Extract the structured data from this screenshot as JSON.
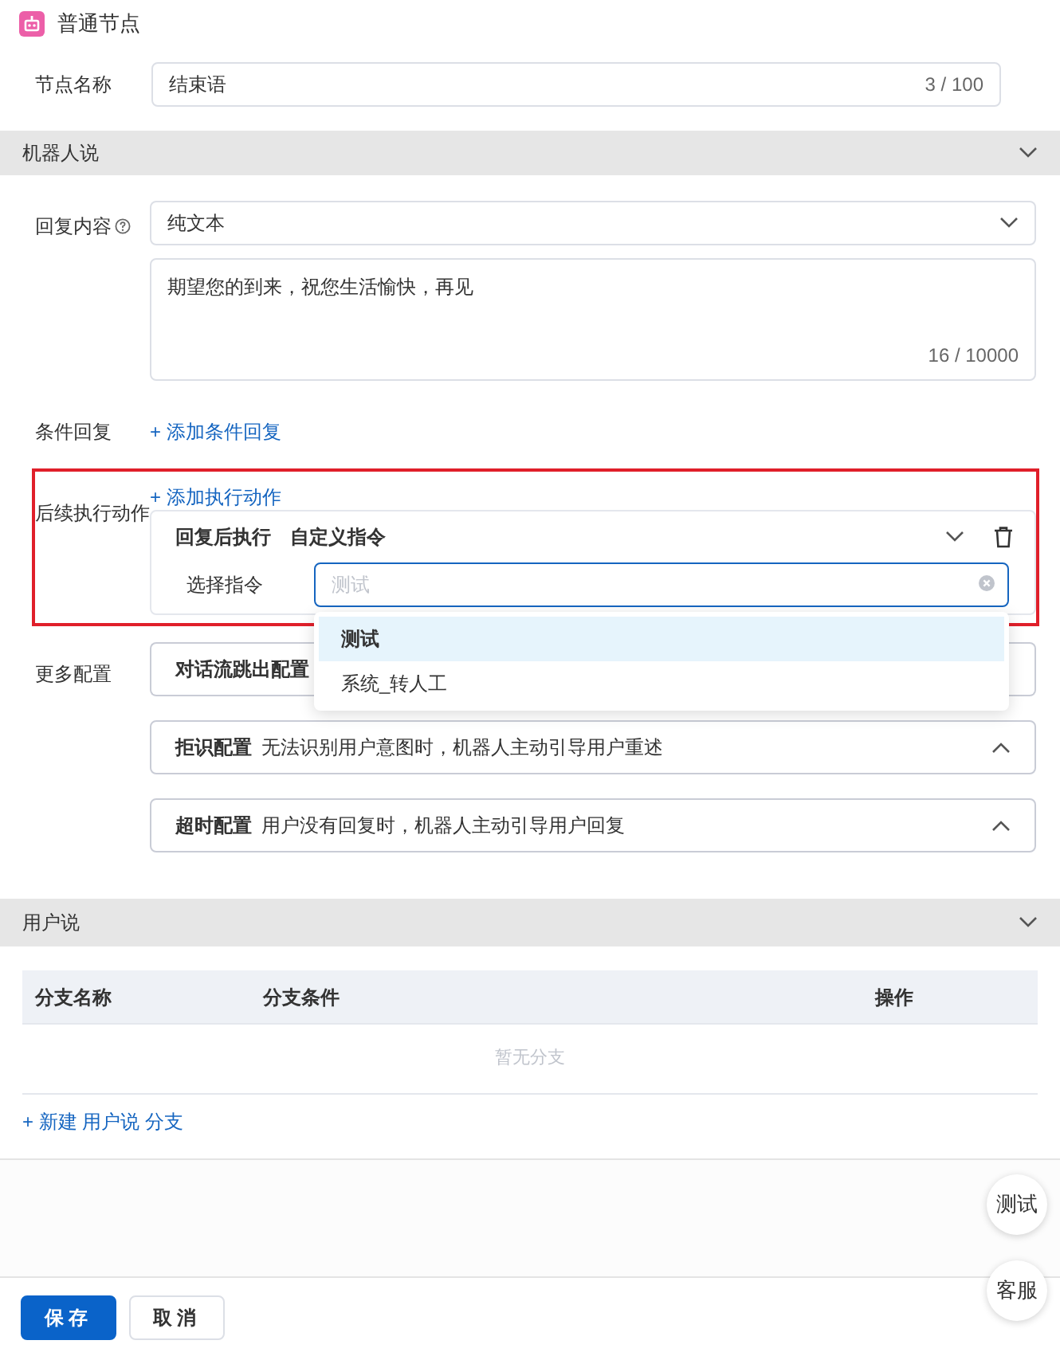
{
  "header": {
    "title": "普通节点"
  },
  "node_name": {
    "label": "节点名称",
    "value": "结束语",
    "counter": "3 / 100"
  },
  "robot_section": {
    "title": "机器人说"
  },
  "reply": {
    "label": "回复内容",
    "type_value": "纯文本",
    "text": "期望您的到来，祝您生活愉快，再见",
    "counter": "16 / 10000"
  },
  "condition": {
    "label": "条件回复",
    "link": "+ 添加条件回复"
  },
  "action": {
    "label": "后续执行动作",
    "link": "+ 添加执行动作",
    "trigger": "回复后执行",
    "type": "自定义指令",
    "command_label": "选择指令",
    "command_placeholder": "测试",
    "options": [
      {
        "label": "测试",
        "selected": true
      },
      {
        "label": "系统_转人工",
        "selected": false
      }
    ]
  },
  "more": {
    "label": "更多配置",
    "configs": [
      {
        "title": "对话流跳出配置"
      },
      {
        "title": "拒识配置",
        "description": "无法识别用户意图时，机器人主动引导用户重述"
      },
      {
        "title": "超时配置",
        "description": "用户没有回复时，机器人主动引导用户回复"
      }
    ]
  },
  "user_section": {
    "title": "用户说",
    "columns": [
      "分支名称",
      "分支条件",
      "操作"
    ],
    "empty": "暂无分支",
    "link": "+ 新建 用户说 分支"
  },
  "float_buttons": [
    "测试",
    "客服"
  ],
  "footer_buttons": [
    {
      "label": "保存",
      "kind": "primary"
    },
    {
      "label": "取消",
      "kind": "default"
    }
  ]
}
